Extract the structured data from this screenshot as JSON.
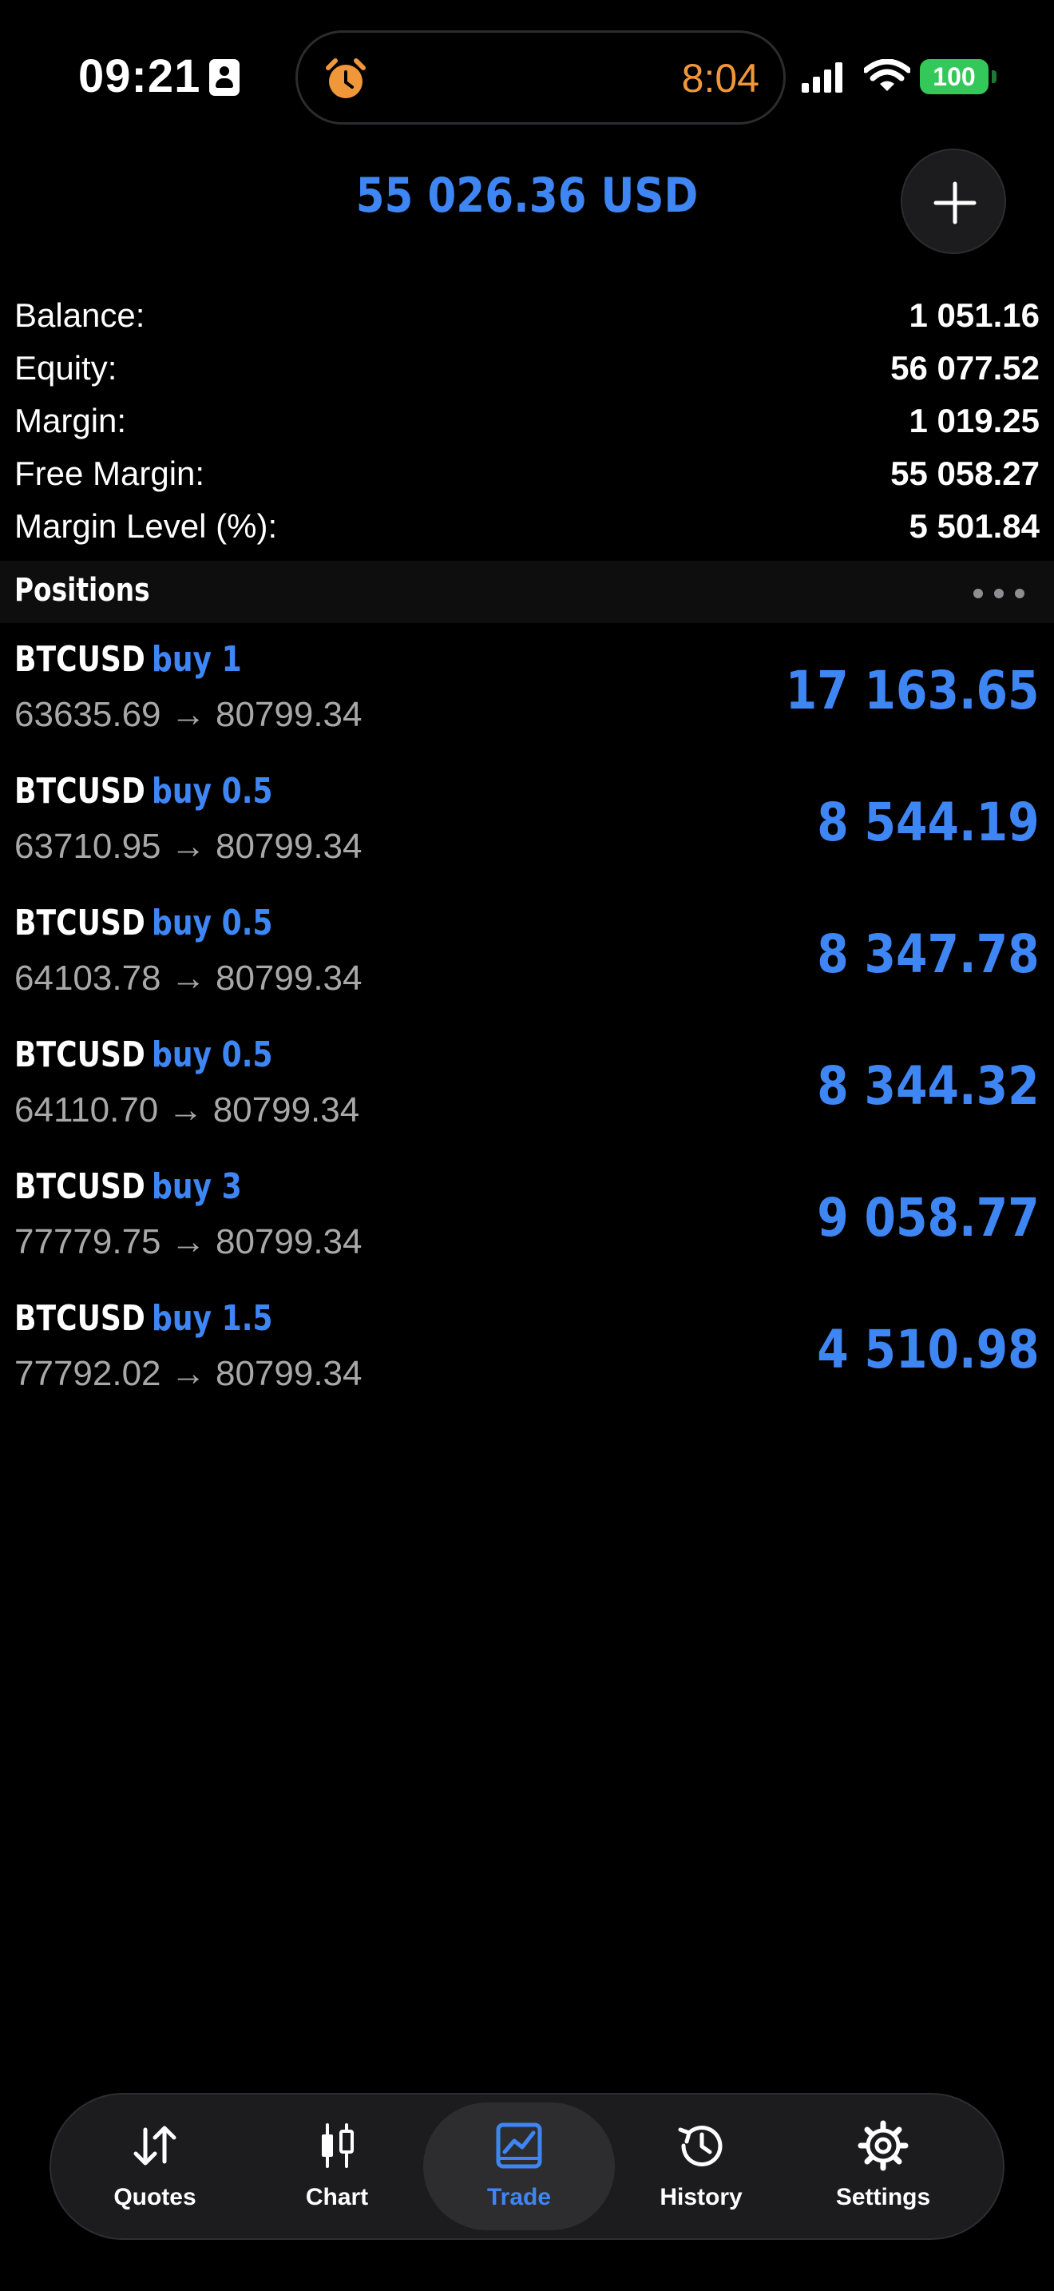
{
  "status_bar": {
    "time": "09:21",
    "timer": "8:04",
    "battery": "100"
  },
  "header": {
    "total": "55 026.36 USD"
  },
  "summary": [
    {
      "label": "Balance:",
      "value": "1 051.16"
    },
    {
      "label": "Equity:",
      "value": "56 077.52"
    },
    {
      "label": "Margin:",
      "value": "1 019.25"
    },
    {
      "label": "Free Margin:",
      "value": "55 058.27"
    },
    {
      "label": "Margin Level (%):",
      "value": "5 501.84"
    }
  ],
  "positions": {
    "title": "Positions",
    "items": [
      {
        "symbol": "BTCUSD",
        "type": "buy 1",
        "prices": "63635.69 → 80799.34",
        "profit": "17 163.65"
      },
      {
        "symbol": "BTCUSD",
        "type": "buy 0.5",
        "prices": "63710.95 → 80799.34",
        "profit": "8 544.19"
      },
      {
        "symbol": "BTCUSD",
        "type": "buy 0.5",
        "prices": "64103.78 → 80799.34",
        "profit": "8 347.78"
      },
      {
        "symbol": "BTCUSD",
        "type": "buy 0.5",
        "prices": "64110.70 → 80799.34",
        "profit": "8 344.32"
      },
      {
        "symbol": "BTCUSD",
        "type": "buy 3",
        "prices": "77779.75 → 80799.34",
        "profit": "9 058.77"
      },
      {
        "symbol": "BTCUSD",
        "type": "buy 1.5",
        "prices": "77792.02 → 80799.34",
        "profit": "4 510.98"
      }
    ]
  },
  "tabs": [
    {
      "label": "Quotes",
      "icon": "quotes-arrows-icon"
    },
    {
      "label": "Chart",
      "icon": "candlestick-icon"
    },
    {
      "label": "Trade",
      "icon": "trade-chart-icon",
      "active": true
    },
    {
      "label": "History",
      "icon": "history-clock-icon"
    },
    {
      "label": "Settings",
      "icon": "gear-icon"
    }
  ],
  "colors": {
    "accent": "#3f86f5",
    "timer": "#f0973a",
    "battery": "#34c759",
    "background": "#000000"
  }
}
